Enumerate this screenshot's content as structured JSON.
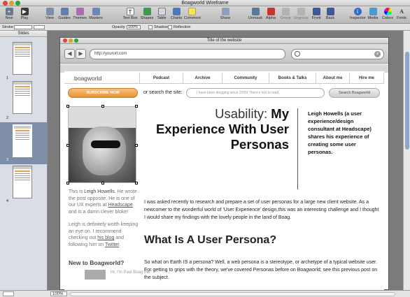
{
  "window": {
    "title": "Boagworld Wireframe"
  },
  "toolbar": {
    "new": "New",
    "play": "Play",
    "view": "View",
    "guides": "Guides",
    "themes": "Themes",
    "masters": "Masters",
    "text_box": "Text Box",
    "shapes": "Shapes",
    "table": "Table",
    "charts": "Charts",
    "comment": "Comment",
    "share": "Share",
    "unmask": "Unmask",
    "alpha": "Alpha",
    "group": "Group",
    "ungroup": "Ungroup",
    "front": "Front",
    "back": "Back",
    "inspector": "Inspector",
    "media": "Media",
    "colors": "Colors",
    "fonts": "Fonts"
  },
  "format_bar": {
    "stroke_label": "Stroke",
    "opacity_label": "Opacity",
    "opacity_value": "100%",
    "shadow_label": "Shadow",
    "reflection_label": "Reflection"
  },
  "sidebar": {
    "header": "Slides",
    "slide_numbers": [
      "1",
      "2",
      "3",
      "4"
    ]
  },
  "status": {
    "zoom": "100%"
  },
  "browser": {
    "title": "Title of the website",
    "url": "http://yoururl.com"
  },
  "site": {
    "logo": "boagworld",
    "nav": [
      "Podcast",
      "Archive",
      "Community",
      "Books & Talks",
      "About me",
      "Hire me"
    ],
    "subscribe": "SUBSCRIBE NOW",
    "or_search": "or search the site:",
    "search_placeholder": "I have been blogging since 2005! There's lots to read.",
    "search_button": "Search Boagworld",
    "headline_light": "Usability: ",
    "headline_bold": "My Experience With User Personas",
    "quote": "Leigh Howells (a user experience/design consultant at Headscape) shares his experience of creating some user personas.",
    "side_p1_a": "This is ",
    "side_p1_name": "Leigh Howells",
    "side_p1_b": ". He wrote the post opposite. He is one of our UX experts at ",
    "side_p1_link": "Headscape",
    "side_p1_c": " and is a damn clever bloke!",
    "side_p2_a": "Leigh is definitely worth keeping an eye on. I recommend checking out ",
    "side_p2_link1": "his blog",
    "side_p2_b": " and following him on ",
    "side_p2_link2": "Twitter",
    "side_p2_c": ".",
    "side_heading": "New to Boagworld?",
    "side_footer_text": "Hi, I'm Paul Boag the",
    "para1": "I was asked recently to research and prepare a set of user personas for a large new client website. As a newcomer to the wonderful world of 'User Experience' design,this was an interesting challenge and I thought I would share my findings with the lovely people in the land of Boag.",
    "h2": "What Is A User Persona?",
    "para2": "So what on Earth IS a persona? Well, a web persona is a stereotype, or archetype of a typical website user. For getting to grips with the theory, we've covered Personas before on Boagworld; see this previous post on the subject."
  },
  "colors": {
    "accent_orange": "#e8942e",
    "selection": "#7f8ea8"
  }
}
